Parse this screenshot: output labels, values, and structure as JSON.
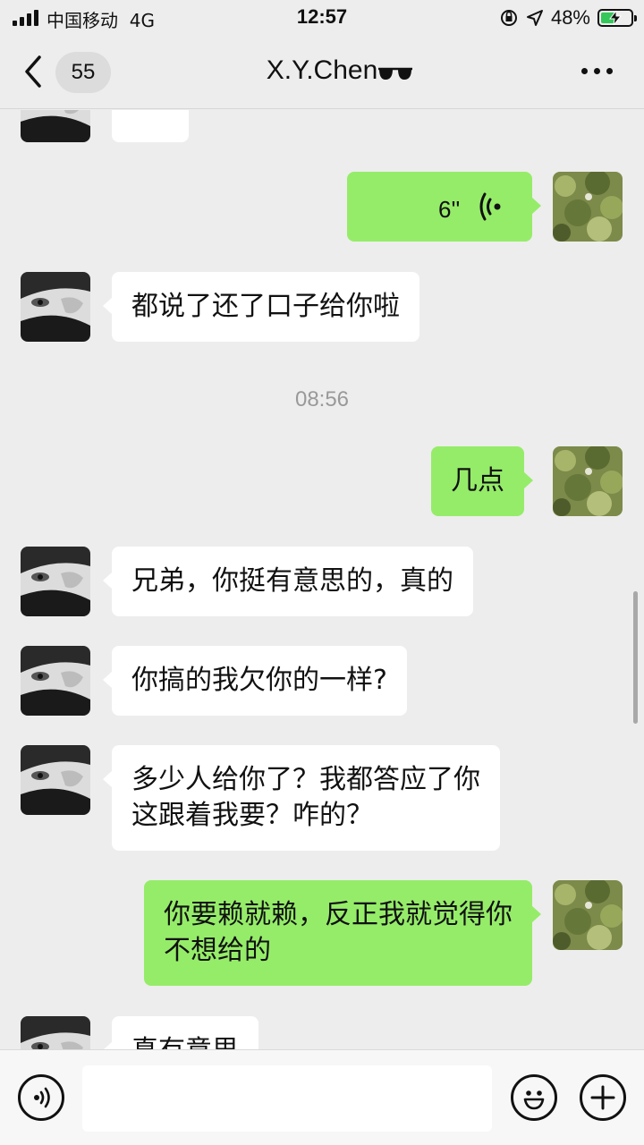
{
  "status_bar": {
    "carrier": "中国移动",
    "network": "4G",
    "time": "12:57",
    "battery_percent": "48%",
    "battery_level": 0.48,
    "icons": [
      "signal-icon",
      "orientation-lock-icon",
      "location-icon",
      "battery-charging-icon"
    ]
  },
  "nav": {
    "unread_count": "55",
    "title": "X.Y.Chen",
    "title_emoji": "sunglasses-icon",
    "icons": [
      "back-icon",
      "more-icon"
    ]
  },
  "messages": [
    {
      "from": "them",
      "type": "text",
      "text": "?"
    },
    {
      "from": "me",
      "type": "voice",
      "duration": "6''"
    },
    {
      "from": "them",
      "type": "text",
      "text": "都说了还了口子给你啦"
    },
    {
      "type": "timestamp",
      "text": "08:56"
    },
    {
      "from": "me",
      "type": "text",
      "text": "几点"
    },
    {
      "from": "them",
      "type": "text",
      "text": "兄弟，你挺有意思的，真的"
    },
    {
      "from": "them",
      "type": "text",
      "text": "你搞的我欠你的一样?"
    },
    {
      "from": "them",
      "type": "text",
      "lines": [
        "多少人给你了？我都答应了你",
        "这跟着我要？咋的？"
      ]
    },
    {
      "from": "me",
      "type": "text",
      "lines": [
        "你要赖就赖，反正我就觉得你",
        "不想给的"
      ]
    },
    {
      "from": "them",
      "type": "text",
      "text": "真有意思"
    }
  ],
  "input_bar": {
    "placeholder": "",
    "icons": [
      "voice-input-icon",
      "emoji-icon",
      "add-icon"
    ]
  },
  "colors": {
    "background": "#ededed",
    "outgoing_bubble": "#95ec69",
    "incoming_bubble": "#ffffff",
    "battery_fill": "#34c759"
  }
}
